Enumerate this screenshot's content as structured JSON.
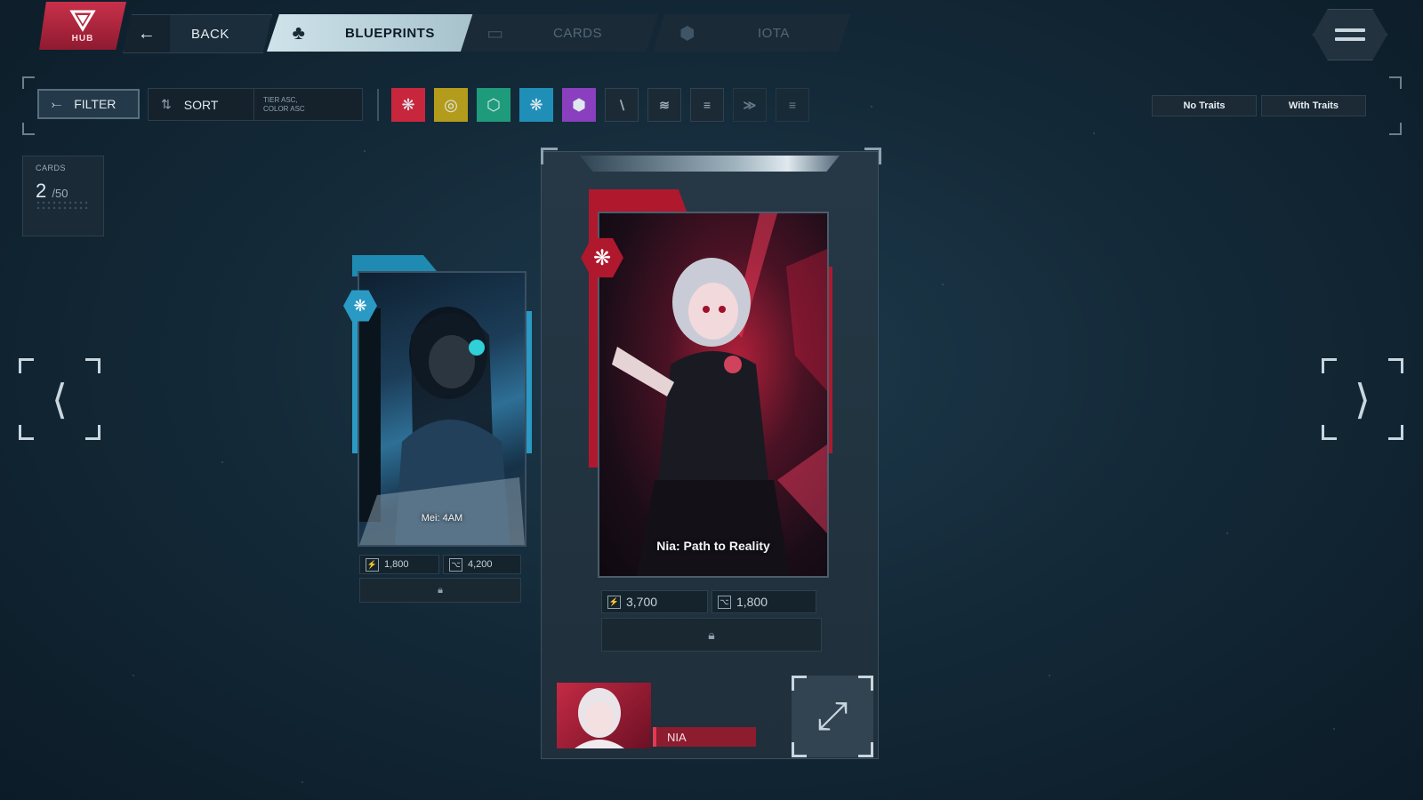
{
  "nav": {
    "hub_label": "HUB",
    "back_label": "BACK",
    "tabs": [
      {
        "label": "BLUEPRINTS",
        "active": true
      },
      {
        "label": "CARDS",
        "active": false
      },
      {
        "label": "IOTA",
        "active": false
      }
    ]
  },
  "toolbar": {
    "filter_label": "FILTER",
    "sort_label": "SORT",
    "sort_value_line1": "TIER ASC,",
    "sort_value_line2": "COLOR ASC",
    "color_chips": [
      {
        "icon": "red-sigil-icon",
        "color": "#c8263d"
      },
      {
        "icon": "gold-signal-icon",
        "color": "#b39b1c"
      },
      {
        "icon": "green-hex-icon",
        "color": "#1e9b7a"
      },
      {
        "icon": "cyan-grid-icon",
        "color": "#1f8fb8"
      },
      {
        "icon": "purple-sigil-icon",
        "color": "#8a3fbf"
      }
    ],
    "tier_chips": [
      "tier-1-icon",
      "tier-2-icon",
      "tier-3-icon",
      "tier-4-icon",
      "tier-5-icon"
    ],
    "trait_buttons": [
      "No Traits",
      "With Traits"
    ]
  },
  "counter": {
    "title": "CARDS",
    "count": "2",
    "total": "/50"
  },
  "cards": [
    {
      "name": "Mei: 4AM",
      "stat1": "1,800",
      "stat2": "4,200",
      "accent": "#2a9ac4"
    },
    {
      "name": "Nia: Path to Reality",
      "stat1": "3,700",
      "stat2": "1,800",
      "accent": "#b0182d"
    }
  ],
  "character": {
    "name": "NIA"
  }
}
